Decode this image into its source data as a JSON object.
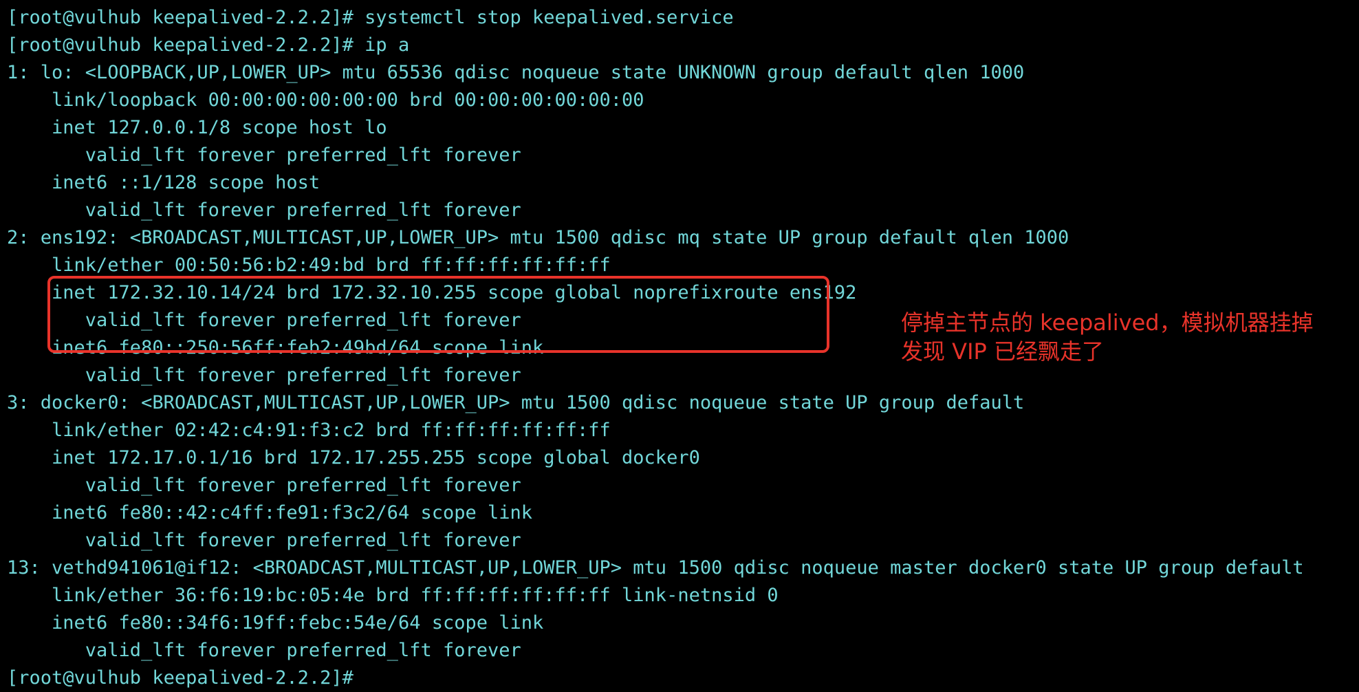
{
  "terminal": {
    "lines": [
      "[root@vulhub keepalived-2.2.2]# systemctl stop keepalived.service",
      "[root@vulhub keepalived-2.2.2]# ip a",
      "1: lo: <LOOPBACK,UP,LOWER_UP> mtu 65536 qdisc noqueue state UNKNOWN group default qlen 1000",
      "    link/loopback 00:00:00:00:00:00 brd 00:00:00:00:00:00",
      "    inet 127.0.0.1/8 scope host lo",
      "       valid_lft forever preferred_lft forever",
      "    inet6 ::1/128 scope host",
      "       valid_lft forever preferred_lft forever",
      "2: ens192: <BROADCAST,MULTICAST,UP,LOWER_UP> mtu 1500 qdisc mq state UP group default qlen 1000",
      "    link/ether 00:50:56:b2:49:bd brd ff:ff:ff:ff:ff:ff",
      "    inet 172.32.10.14/24 brd 172.32.10.255 scope global noprefixroute ens192",
      "       valid_lft forever preferred_lft forever",
      "    inet6 fe80::250:56ff:feb2:49bd/64 scope link",
      "       valid_lft forever preferred_lft forever",
      "3: docker0: <BROADCAST,MULTICAST,UP,LOWER_UP> mtu 1500 qdisc noqueue state UP group default",
      "    link/ether 02:42:c4:91:f3:c2 brd ff:ff:ff:ff:ff:ff",
      "    inet 172.17.0.1/16 brd 172.17.255.255 scope global docker0",
      "       valid_lft forever preferred_lft forever",
      "    inet6 fe80::42:c4ff:fe91:f3c2/64 scope link",
      "       valid_lft forever preferred_lft forever",
      "13: vethd941061@if12: <BROADCAST,MULTICAST,UP,LOWER_UP> mtu 1500 qdisc noqueue master docker0 state UP group default",
      "    link/ether 36:f6:19:bc:05:4e brd ff:ff:ff:ff:ff:ff link-netnsid 0",
      "    inet6 fe80::34f6:19ff:febc:54e/64 scope link",
      "       valid_lft forever preferred_lft forever",
      "[root@vulhub keepalived-2.2.2]#"
    ]
  },
  "annotation": {
    "line1": "停掉主节点的 keepalived，模拟机器挂掉",
    "line2": "发现 VIP 已经飘走了"
  },
  "colors": {
    "background": "#000000",
    "terminal_text": "#72d7d9",
    "annotation": "#e8332a"
  }
}
